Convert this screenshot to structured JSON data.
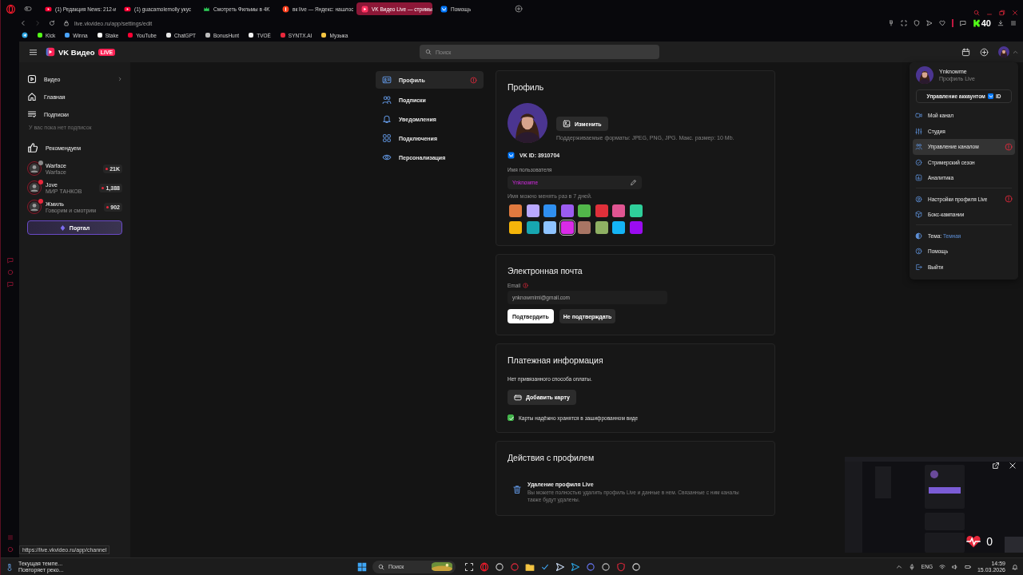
{
  "browser": {
    "tabs": [
      {
        "label": "(1) Редакция News: 212-и",
        "kind": "youtube",
        "selected": false
      },
      {
        "label": "(1) guacamolemolly укус",
        "kind": "youtube",
        "selected": false
      },
      {
        "label": "Смотреть Фильмы в 4K",
        "kind": "crown",
        "selected": false
      },
      {
        "label": "вк live — Яндекс: нашлос",
        "kind": "yandex",
        "selected": false
      },
      {
        "label": "VK Видео Live — стримы",
        "kind": "vklive",
        "selected": true
      },
      {
        "label": "Помощь",
        "kind": "vk",
        "selected": false
      }
    ],
    "address": "live.vkvideo.ru/app/settings/edit",
    "extension_badge": "40",
    "bookmarks": [
      {
        "label": "Kick",
        "color": "#53fc18"
      },
      {
        "label": "Winna",
        "color": "#4aa3ff"
      },
      {
        "label": "Stake",
        "color": "#ffffff"
      },
      {
        "label": "YouTube",
        "color": "#ff0033"
      },
      {
        "label": "ChatGPT",
        "color": "#e8e8e8"
      },
      {
        "label": "BonusHunt",
        "color": "#bdbdbd"
      },
      {
        "label": "TVOЁ",
        "color": "#f2f2f2"
      },
      {
        "label": "SYNTX.AI",
        "color": "#e8283c"
      },
      {
        "label": "Музыка",
        "color": "#f5c542"
      }
    ]
  },
  "header": {
    "logo": "VK Видео",
    "logo_badge": "LIVE",
    "search": {
      "placeholder": "Поиск"
    }
  },
  "sidebar": {
    "items": [
      {
        "label": "Видео",
        "kind": "video",
        "arrow": true
      },
      {
        "label": "Главная",
        "kind": "home",
        "arrow": false
      },
      {
        "label": "Подписки",
        "kind": "subs",
        "arrow": false
      }
    ],
    "note": "У вас пока нет подписок",
    "section": "Рекомендуем",
    "channels": [
      {
        "name": "Warface",
        "subtitle": "Warface",
        "viewers": "21K",
        "color": "#8a8a8a"
      },
      {
        "name": "Jove",
        "subtitle": "МИР ТАНКОВ",
        "viewers": "1,388",
        "color": "#e8283c"
      },
      {
        "name": "Жмиль",
        "subtitle": "Говорим и смотрим",
        "viewers": "902",
        "color": "#e8283c"
      }
    ],
    "portal": "Портал"
  },
  "settings_nav": [
    {
      "label": "Профиль",
      "kind": "idcard",
      "selected": true,
      "warning": true
    },
    {
      "label": "Подписки",
      "kind": "users",
      "selected": false,
      "warning": false
    },
    {
      "label": "Уведомления",
      "kind": "bell",
      "selected": false,
      "warning": false
    },
    {
      "label": "Подключения",
      "kind": "grid",
      "selected": false,
      "warning": false
    },
    {
      "label": "Персонализация",
      "kind": "eye",
      "selected": false,
      "warning": false
    }
  ],
  "profile": {
    "title": "Профиль",
    "change_button": "Изменить",
    "formats_hint": "Поддерживаемые форматы: JPEG, PNG, JPG. Макс. размер: 10 Mb.",
    "vk_id": "VK ID: 3910704",
    "username_label": "Имя пользователя",
    "username": "Ynknowme",
    "username_hint": "Имя можно менять раз в 7 дней.",
    "colors": [
      {
        "color": "#e07a3f",
        "selected": false
      },
      {
        "color": "#b9a8ff",
        "selected": false
      },
      {
        "color": "#2f8ff0",
        "selected": false
      },
      {
        "color": "#9b5cf0",
        "selected": false
      },
      {
        "color": "#52b74a",
        "selected": false
      },
      {
        "color": "#e0303a",
        "selected": false
      },
      {
        "color": "#e05592",
        "selected": false
      },
      {
        "color": "#2fcf9a",
        "selected": false
      },
      {
        "color": "#f5b50a",
        "selected": false
      },
      {
        "color": "#17a6b0",
        "selected": false
      },
      {
        "color": "#8ec3ff",
        "selected": false
      },
      {
        "color": "#d92be8",
        "selected": true
      },
      {
        "color": "#a87564",
        "selected": false
      },
      {
        "color": "#8fb063",
        "selected": false
      },
      {
        "color": "#14b4f5",
        "selected": false
      },
      {
        "color": "#9a0cf0",
        "selected": false
      }
    ]
  },
  "email": {
    "title": "Электронная почта",
    "label": "Email",
    "value": "ynknowmimi@gmail.com",
    "confirm": "Подтвердить",
    "decline": "Не подтверждать"
  },
  "payment": {
    "title": "Платежная информация",
    "text": "Нет привязанного способа оплаты.",
    "add_card": "Добавить карту",
    "secure_note": "Карты надёжно хранятся в зашифрованном виде",
    "secure_checked": true
  },
  "actions": {
    "title": "Действия с профилем",
    "delete_title": "Удаление профиля Live",
    "delete_text": "Вы можете полностью удалить профиль Live и данные в нем. Связанные с ним каналы также будут удалены."
  },
  "account_menu": {
    "name": "Ynknowme",
    "subtitle": "Профиль Live",
    "manage": "Управление аккаунтом",
    "manage_badge": "ID",
    "groups": [
      [
        {
          "label": "Мой канал",
          "kind": "camera",
          "hovered": false,
          "warning": false
        },
        {
          "label": "Студия",
          "kind": "sliders",
          "hovered": false,
          "warning": false
        },
        {
          "label": "Управление каналом",
          "kind": "users",
          "hovered": true,
          "warning": true
        },
        {
          "label": "Стримерский сезон",
          "kind": "season",
          "hovered": false,
          "warning": false
        },
        {
          "label": "Аналитика",
          "kind": "chart",
          "hovered": false,
          "warning": false
        }
      ],
      [
        {
          "label": "Настройки профиля Live",
          "kind": "usergear",
          "hovered": false,
          "warning": true
        },
        {
          "label": "Бокс-кампании",
          "kind": "box",
          "hovered": false,
          "warning": false
        }
      ]
    ],
    "theme_label": "Тема:",
    "theme_value": "Темная",
    "help": "Помощь",
    "logout": "Выйти"
  },
  "mini_player": {
    "count": "0"
  },
  "status_link": "https://live.vkvideo.ru/app/channel",
  "taskbar": {
    "weather_title": "Текущая темпе...",
    "weather_text": "Повторяет реко...",
    "search": "Поиск",
    "language": "ENG",
    "time": "14:59",
    "date": "15.03.2026"
  }
}
